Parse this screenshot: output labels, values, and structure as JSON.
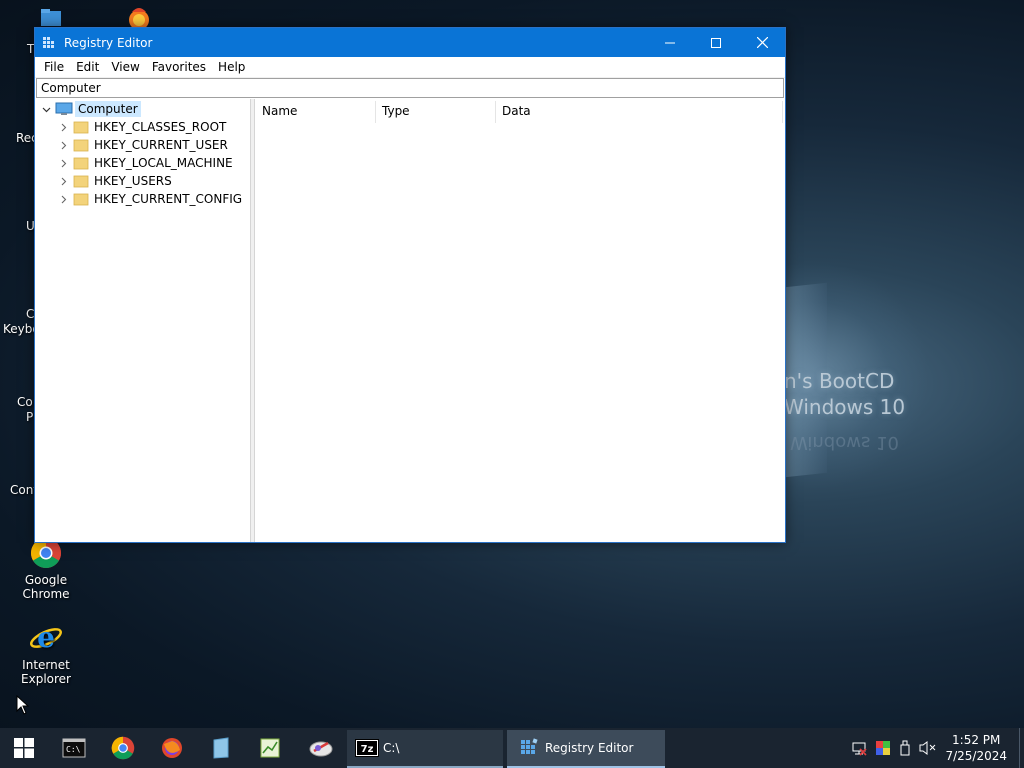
{
  "desktop": {
    "icons": [
      {
        "label": "Google Chrome"
      },
      {
        "label": "Internet Explorer"
      }
    ],
    "partial_labels": [
      "T",
      "Rec",
      "U",
      "C",
      "Keybo",
      "Co",
      "P",
      "Cont"
    ],
    "wallpaper_text_1": "n's BootCD",
    "wallpaper_text_2": "Windows 10"
  },
  "window": {
    "title": "Registry Editor",
    "menu": [
      "File",
      "Edit",
      "View",
      "Favorites",
      "Help"
    ],
    "address": "Computer",
    "tree": {
      "root": "Computer",
      "children": [
        "HKEY_CLASSES_ROOT",
        "HKEY_CURRENT_USER",
        "HKEY_LOCAL_MACHINE",
        "HKEY_USERS",
        "HKEY_CURRENT_CONFIG"
      ]
    },
    "columns": [
      "Name",
      "Type",
      "Data"
    ]
  },
  "taskbar": {
    "tasks": [
      {
        "label": "C:\\"
      },
      {
        "label": "Registry Editor"
      }
    ],
    "clock_time": "1:52 PM",
    "clock_date": "7/25/2024"
  },
  "colors": {
    "titlebar": "#0a74d6",
    "selection": "#cce8ff",
    "taskbar": "#1a2430",
    "active_task": "#3d4b5a"
  }
}
